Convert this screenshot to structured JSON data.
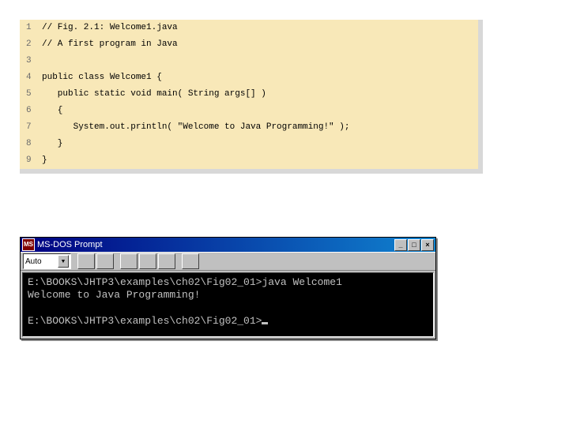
{
  "code": {
    "lines": [
      {
        "num": "1",
        "text": "// Fig. 2.1: Welcome1.java"
      },
      {
        "num": "2",
        "text": "// A first program in Java"
      },
      {
        "num": "3",
        "text": ""
      },
      {
        "num": "4",
        "text": "public class Welcome1 {"
      },
      {
        "num": "5",
        "text": "   public static void main( String args[] )"
      },
      {
        "num": "6",
        "text": "   {"
      },
      {
        "num": "7",
        "text": "      System.out.println( \"Welcome to Java Programming!\" );"
      },
      {
        "num": "8",
        "text": "   }"
      },
      {
        "num": "9",
        "text": "}"
      }
    ]
  },
  "dos": {
    "title": "MS-DOS Prompt",
    "toolbar": {
      "dropdown": "Auto"
    },
    "buttons": {
      "min": "_",
      "max": "□",
      "close": "×"
    },
    "output": {
      "line1": "E:\\BOOKS\\JHTP3\\examples\\ch02\\Fig02_01>java Welcome1",
      "line2": "Welcome to Java Programming!",
      "line3": "",
      "line4": "E:\\BOOKS\\JHTP3\\examples\\ch02\\Fig02_01>"
    }
  }
}
